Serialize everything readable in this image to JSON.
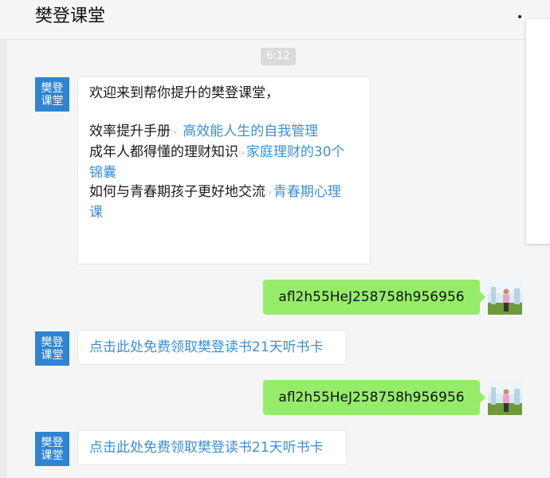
{
  "header": {
    "title": "樊登课堂",
    "menu_icon": "more-dots-icon"
  },
  "timestamp": "6:12",
  "bot_avatar": {
    "line1": "樊登",
    "line2": "课堂",
    "color": "#2f84d2"
  },
  "messages": {
    "welcome": {
      "greeting": "欢迎来到帮你提升的樊登课堂，",
      "row1_text": "效率提升手册",
      "row1_link": "高效能人生的自我管理",
      "row2_text": "成年人都得懂的理财知识",
      "row2_link_a": "家庭理财的30个",
      "row2_link_b": "锦囊",
      "row3_text": "如何与青春期孩子更好地交流",
      "row3_link_a": "青春期心理",
      "row3_link_b": "课",
      "hand_icon": "☞"
    },
    "user_code_1": "afl2h55HeJ258758h956956",
    "reply_link_1": "点击此处免费领取樊登读书21天听书卡",
    "user_code_2": "afl2h55HeJ258758h956956",
    "reply_link_2": "点击此处免费领取樊登读书21天听书卡"
  },
  "colors": {
    "accent_link": "#3b8fd6",
    "user_bubble": "#95ec69",
    "bot_bubble": "#ffffff",
    "background": "#f5f5f5"
  }
}
